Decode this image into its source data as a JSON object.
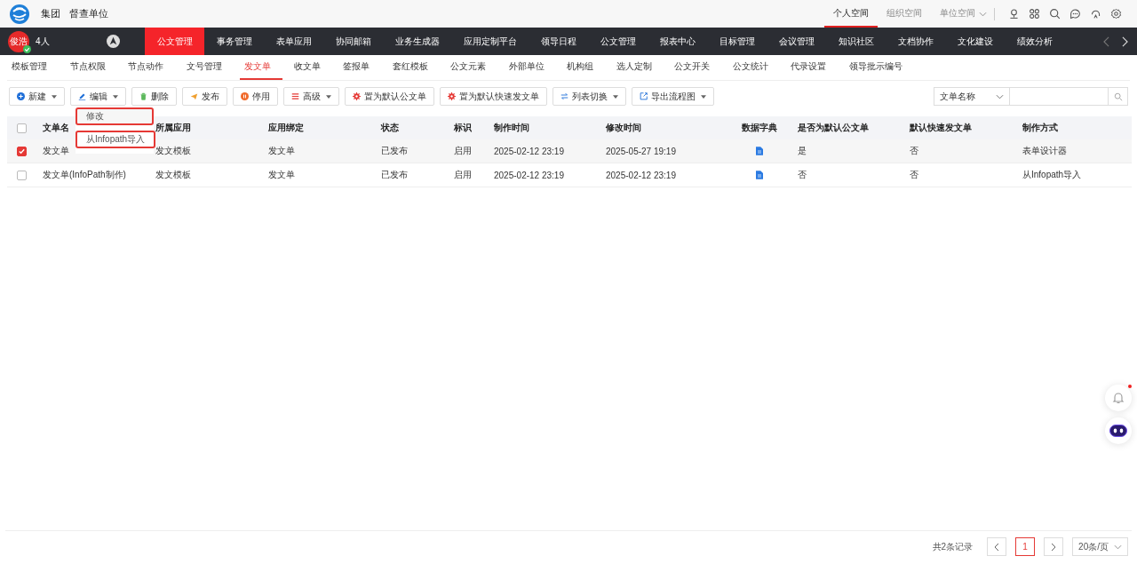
{
  "header": {
    "org": "集团",
    "unit": "督查单位",
    "spaces": [
      {
        "label": "个人空间",
        "selected": true,
        "dropdown": false
      },
      {
        "label": "组织空间",
        "selected": false,
        "dropdown": false
      },
      {
        "label": "单位空间",
        "selected": false,
        "dropdown": true
      }
    ]
  },
  "user": {
    "avatar": "俊浩",
    "online": true,
    "count": "4人"
  },
  "nav": [
    {
      "label": "公文管理",
      "selected": true
    },
    {
      "label": "事务管理",
      "selected": false
    },
    {
      "label": "表单应用",
      "selected": false
    },
    {
      "label": "协同邮箱",
      "selected": false
    },
    {
      "label": "业务生成器",
      "selected": false
    },
    {
      "label": "应用定制平台",
      "selected": false
    },
    {
      "label": "领导日程",
      "selected": false
    },
    {
      "label": "公文管理",
      "selected": false
    },
    {
      "label": "报表中心",
      "selected": false
    },
    {
      "label": "目标管理",
      "selected": false
    },
    {
      "label": "会议管理",
      "selected": false
    },
    {
      "label": "知识社区",
      "selected": false
    },
    {
      "label": "文档协作",
      "selected": false
    },
    {
      "label": "文化建设",
      "selected": false
    },
    {
      "label": "绩效分析",
      "selected": false
    }
  ],
  "subnav": [
    {
      "label": "模板管理",
      "selected": false
    },
    {
      "label": "节点权限",
      "selected": false
    },
    {
      "label": "节点动作",
      "selected": false
    },
    {
      "label": "文号管理",
      "selected": false
    },
    {
      "label": "发文单",
      "selected": true
    },
    {
      "label": "收文单",
      "selected": false
    },
    {
      "label": "签报单",
      "selected": false
    },
    {
      "label": "套红模板",
      "selected": false
    },
    {
      "label": "公文元素",
      "selected": false
    },
    {
      "label": "外部单位",
      "selected": false
    },
    {
      "label": "机构组",
      "selected": false
    },
    {
      "label": "选人定制",
      "selected": false
    },
    {
      "label": "公文开关",
      "selected": false
    },
    {
      "label": "公文统计",
      "selected": false
    },
    {
      "label": "代录设置",
      "selected": false
    },
    {
      "label": "领导批示编号",
      "selected": false
    }
  ],
  "toolbar": [
    {
      "label": "新建",
      "dropdown": true
    },
    {
      "label": "编辑",
      "dropdown": true
    },
    {
      "label": "删除",
      "dropdown": false
    },
    {
      "label": "发布",
      "dropdown": false
    },
    {
      "label": "停用",
      "dropdown": false
    },
    {
      "label": "高级",
      "dropdown": true
    },
    {
      "label": "置为默认公文单",
      "dropdown": false
    },
    {
      "label": "置为默认快速发文单",
      "dropdown": false
    },
    {
      "label": "列表切换",
      "dropdown": true
    },
    {
      "label": "导出流程图",
      "dropdown": true
    }
  ],
  "edit_menu": [
    "修改",
    "从Infopath导入"
  ],
  "search": {
    "field": "文单名称"
  },
  "table": {
    "all_selected": false,
    "columns": [
      "文单名",
      "所属应用",
      "应用绑定",
      "状态",
      "标识",
      "制作时间",
      "修改时间",
      "数据字典",
      "是否为默认公文单",
      "默认快速发文单",
      "制作方式"
    ],
    "rows": [
      {
        "selected": true,
        "cells": [
          "发文单",
          "发文模板",
          "发文单",
          "已发布",
          "启用",
          "2025-02-12 23:19",
          "2025-05-27 19:19",
          "",
          "是",
          "否",
          "表单设计器"
        ]
      },
      {
        "selected": false,
        "cells": [
          "发文单(InfoPath制作)",
          "发文模板",
          "发文单",
          "已发布",
          "启用",
          "2025-02-12 23:19",
          "2025-02-12 23:19",
          "",
          "否",
          "否",
          "从Infopath导入"
        ]
      }
    ]
  },
  "pagination": {
    "total": "共2条记录",
    "pages": [
      {
        "label": "1",
        "selected": true
      }
    ],
    "page_size": "20条/页"
  },
  "notifications": {
    "unread": true
  }
}
